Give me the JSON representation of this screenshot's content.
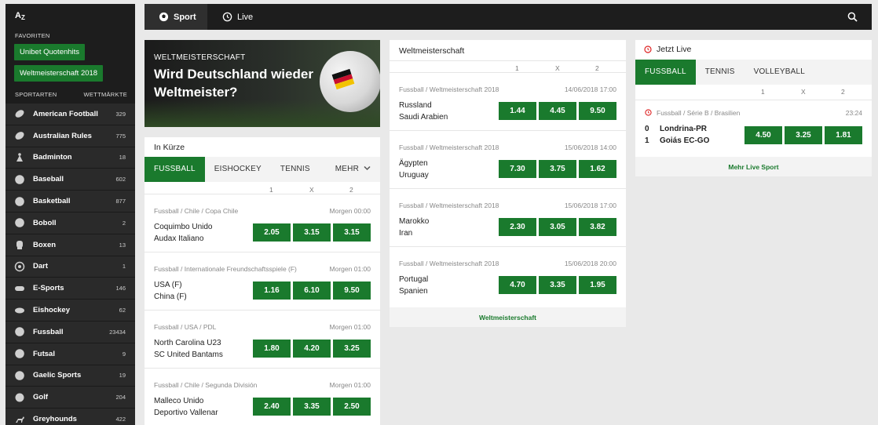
{
  "sidebar": {
    "az": "A",
    "az_sub": "Z",
    "favorites_title": "FAVORITEN",
    "favorites": [
      "Unibet Quotenhits",
      "Weltmeisterschaft 2018"
    ],
    "sports_title": "SPORTARTEN",
    "markets_title": "WETTMÄRKTE",
    "sports": [
      {
        "name": "American Football",
        "count": "329",
        "icon": "american-football-icon"
      },
      {
        "name": "Australian Rules",
        "count": "775",
        "icon": "australian-rules-icon"
      },
      {
        "name": "Badminton",
        "count": "18",
        "icon": "badminton-icon"
      },
      {
        "name": "Baseball",
        "count": "602",
        "icon": "baseball-icon"
      },
      {
        "name": "Basketball",
        "count": "877",
        "icon": "basketball-icon"
      },
      {
        "name": "Boboll",
        "count": "2",
        "icon": "boboll-icon"
      },
      {
        "name": "Boxen",
        "count": "13",
        "icon": "boxing-glove-icon"
      },
      {
        "name": "Dart",
        "count": "1",
        "icon": "dart-icon"
      },
      {
        "name": "E-Sports",
        "count": "146",
        "icon": "gamepad-icon"
      },
      {
        "name": "Eishockey",
        "count": "62",
        "icon": "puck-icon"
      },
      {
        "name": "Fussball",
        "count": "23434",
        "icon": "soccer-ball-icon"
      },
      {
        "name": "Futsal",
        "count": "9",
        "icon": "futsal-icon"
      },
      {
        "name": "Gaelic Sports",
        "count": "19",
        "icon": "gaelic-icon"
      },
      {
        "name": "Golf",
        "count": "204",
        "icon": "golf-icon"
      },
      {
        "name": "Greyhounds",
        "count": "422",
        "icon": "greyhound-icon"
      }
    ]
  },
  "topbar": {
    "tabs": [
      {
        "label": "Sport",
        "icon": "soccer-ball-icon"
      },
      {
        "label": "Live",
        "icon": "clock-icon"
      }
    ]
  },
  "banner": {
    "kicker": "WELTMEISTERSCHAFT",
    "headline": "Wird Deutschland wieder Weltmeister?"
  },
  "in_kurze": {
    "title": "In Kürze",
    "tabs": [
      "FUSSBALL",
      "EISHOCKEY",
      "TENNIS"
    ],
    "more": "MEHR",
    "cols": [
      "1",
      "X",
      "2"
    ],
    "matches": [
      {
        "league": "Fussball / Chile / Copa Chile",
        "time": "Morgen 00:00",
        "home": "Coquimbo Unido",
        "away": "Audax Italiano",
        "odds": [
          "2.05",
          "3.15",
          "3.15"
        ]
      },
      {
        "league": "Fussball / Internationale Freundschaftsspiele (F)",
        "time": "Morgen 01:00",
        "home": "USA (F)",
        "away": "China (F)",
        "odds": [
          "1.16",
          "6.10",
          "9.50"
        ]
      },
      {
        "league": "Fussball / USA / PDL",
        "time": "Morgen 01:00",
        "home": "North Carolina U23",
        "away": "SC United Bantams",
        "odds": [
          "1.80",
          "4.20",
          "3.25"
        ]
      },
      {
        "league": "Fussball / Chile / Segunda División",
        "time": "Morgen 01:00",
        "home": "Malleco Unido",
        "away": "Deportivo Vallenar",
        "odds": [
          "2.40",
          "3.35",
          "2.50"
        ]
      }
    ]
  },
  "wm": {
    "title": "Weltmeisterschaft",
    "cols": [
      "1",
      "X",
      "2"
    ],
    "matches": [
      {
        "league": "Fussball / Weltmeisterschaft 2018",
        "time": "14/06/2018 17:00",
        "home": "Russland",
        "away": "Saudi Arabien",
        "odds": [
          "1.44",
          "4.45",
          "9.50"
        ]
      },
      {
        "league": "Fussball / Weltmeisterschaft 2018",
        "time": "15/06/2018 14:00",
        "home": "Ägypten",
        "away": "Uruguay",
        "odds": [
          "7.30",
          "3.75",
          "1.62"
        ]
      },
      {
        "league": "Fussball / Weltmeisterschaft 2018",
        "time": "15/06/2018 17:00",
        "home": "Marokko",
        "away": "Iran",
        "odds": [
          "2.30",
          "3.05",
          "3.82"
        ]
      },
      {
        "league": "Fussball / Weltmeisterschaft 2018",
        "time": "15/06/2018 20:00",
        "home": "Portugal",
        "away": "Spanien",
        "odds": [
          "4.70",
          "3.35",
          "1.95"
        ]
      }
    ],
    "footer": "Weltmeisterschaft"
  },
  "live": {
    "title": "Jetzt Live",
    "tabs": [
      "FUSSBALL",
      "TENNIS",
      "VOLLEYBALL"
    ],
    "cols": [
      "1",
      "X",
      "2"
    ],
    "match": {
      "league": "Fussball / Série B / Brasilien",
      "time": "23:24",
      "home_score": "0",
      "away_score": "1",
      "home": "Londrina-PR",
      "away": "Goiás EC-GO",
      "odds": [
        "4.50",
        "3.25",
        "1.81"
      ]
    },
    "footer": "Mehr Live Sport"
  },
  "colors": {
    "accent": "#1a7a2d",
    "dark": "#1d1d1d"
  }
}
